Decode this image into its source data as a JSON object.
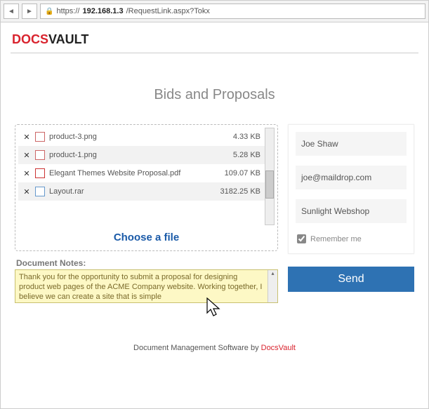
{
  "browser": {
    "url_prefix": "https://",
    "url_host": "192.168.1.3",
    "url_path": "/RequestLink.aspx?Tokx"
  },
  "logo": {
    "part1": "DOCS",
    "part2": "VAULT"
  },
  "title": "Bids and Proposals",
  "files": [
    {
      "name": "product-3.png",
      "size": "4.33 KB",
      "type": "img"
    },
    {
      "name": "product-1.png",
      "size": "5.28 KB",
      "type": "img"
    },
    {
      "name": "Elegant Themes Website Proposal.pdf",
      "size": "109.07 KB",
      "type": "pdf"
    },
    {
      "name": "Layout.rar",
      "size": "3182.25 KB",
      "type": "rar"
    }
  ],
  "choose_label": "Choose a file",
  "notes_label": "Document Notes:",
  "notes_value": "Thank you for the opportunity to submit a proposal for designing product web pages of the ACME Company website. Working together, I believe we can create a site that is simple",
  "form": {
    "name": "Joe Shaw",
    "email": "joe@maildrop.com",
    "company": "Sunlight Webshop",
    "remember_label": "Remember me",
    "remember_checked": true
  },
  "send_label": "Send",
  "footer_text": "Document Management Software by ",
  "footer_link": "DocsVault"
}
